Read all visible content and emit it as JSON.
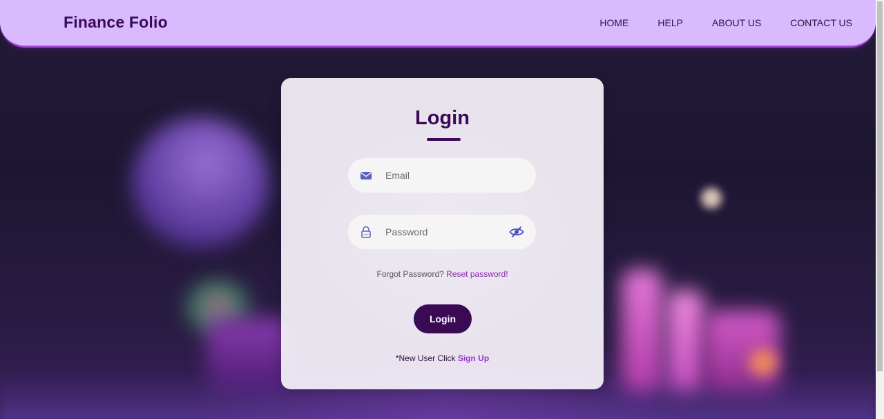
{
  "header": {
    "brand": "Finance Folio",
    "nav": [
      "HOME",
      "HELP",
      "ABOUT US",
      "CONTACT US"
    ]
  },
  "login": {
    "title": "Login",
    "email_placeholder": "Email",
    "password_placeholder": "Password",
    "forgot_text": "Forgot Password?",
    "reset_link": "Reset password!",
    "submit_label": "Login",
    "new_user_text": "*New User Click",
    "signup_link": "Sign Up"
  },
  "colors": {
    "header_bg": "#d9baff",
    "header_border": "#a243d4",
    "primary": "#3a0a55",
    "link": "#8a2ca8",
    "icon": "#5a5fc7"
  },
  "icons": {
    "email": "envelope-icon",
    "password": "lock-icon",
    "visibility": "eye-slash-icon"
  }
}
